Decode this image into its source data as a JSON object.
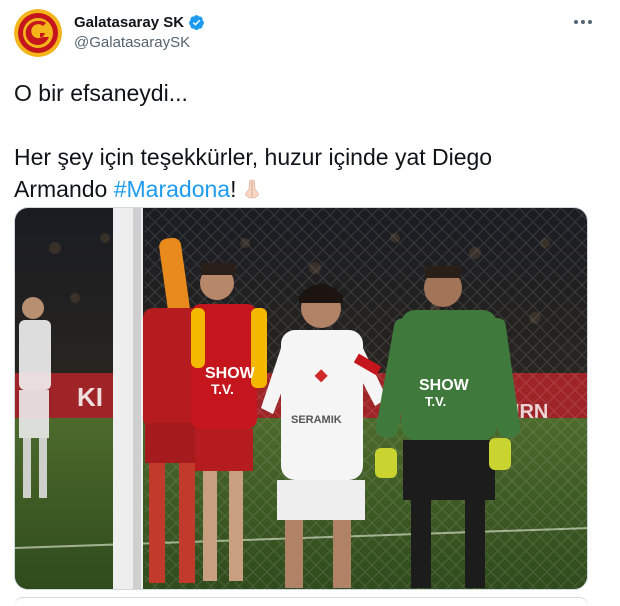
{
  "author": {
    "name": "Galatasaray SK",
    "handle": "@GalatasaraySK",
    "verified": true
  },
  "tweet": {
    "line1": "O bir efsaneydi...",
    "line2": "Her şey için teşekkürler, huzur içinde yat Diego",
    "line3_prefix": "Armando ",
    "hashtag": "#Maradona",
    "line3_suffix": "!",
    "emoji": "praying-hands"
  },
  "media": {
    "alt": "Football photo: Maradona in a white Sevilla kit with Galatasaray players",
    "shirt_sponsor": "SHOW TV",
    "kit_sponsor": "SERAMIK"
  },
  "icons": {
    "more": "more-options-icon",
    "verified": "verified-badge-icon"
  },
  "colors": {
    "accent": "#1d9bf0",
    "galatasaray_red": "#c4161c",
    "galatasaray_yellow": "#f5b800",
    "keeper_green": "#3f7a3c"
  }
}
